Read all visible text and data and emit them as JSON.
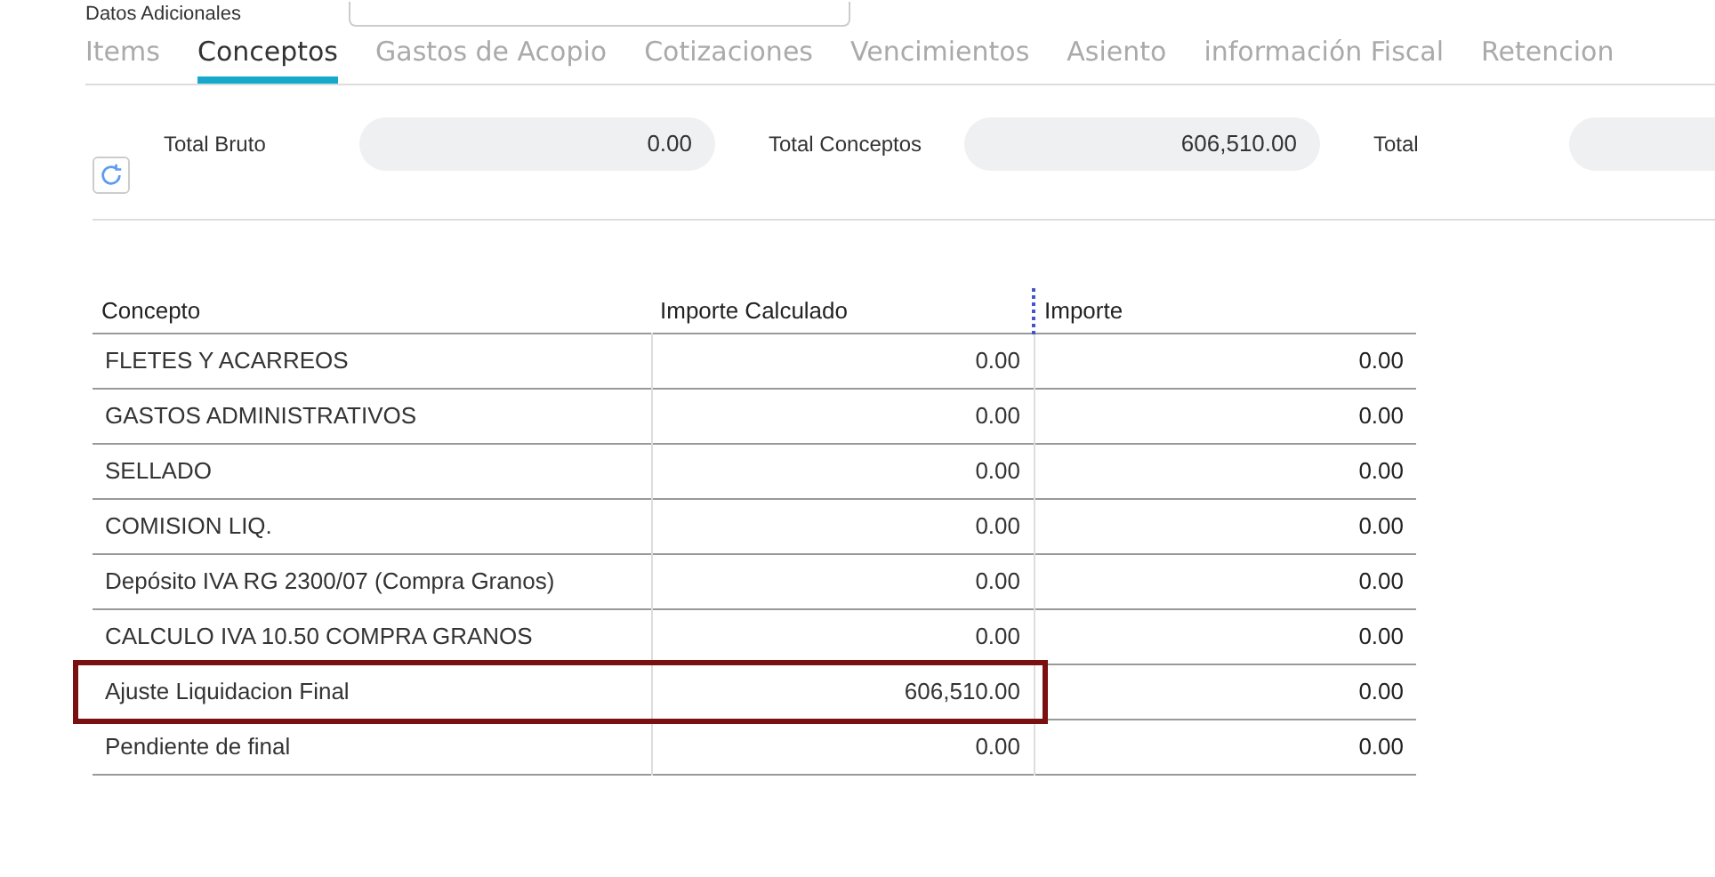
{
  "top_field": {
    "label": "Datos Adicionales"
  },
  "tabs": [
    {
      "label": "Items",
      "selected": false
    },
    {
      "label": "Conceptos",
      "selected": true
    },
    {
      "label": "Gastos de Acopio",
      "selected": false
    },
    {
      "label": "Cotizaciones",
      "selected": false
    },
    {
      "label": "Vencimientos",
      "selected": false
    },
    {
      "label": "Asiento",
      "selected": false
    },
    {
      "label": "información Fiscal",
      "selected": false
    },
    {
      "label": "Retencion",
      "selected": false
    }
  ],
  "totals": [
    {
      "label": "Total Bruto",
      "value": "0.00"
    },
    {
      "label": "Total Conceptos",
      "value": "606,510.00"
    },
    {
      "label": "Total"
    }
  ],
  "table": {
    "columns": [
      "Concepto",
      "Importe Calculado",
      "Importe"
    ],
    "rows": [
      {
        "concepto": "FLETES Y ACARREOS",
        "calculado": "0.00",
        "importe": "0.00",
        "highlighted": false
      },
      {
        "concepto": "GASTOS ADMINISTRATIVOS",
        "calculado": "0.00",
        "importe": "0.00",
        "highlighted": false
      },
      {
        "concepto": "SELLADO",
        "calculado": "0.00",
        "importe": "0.00",
        "highlighted": false
      },
      {
        "concepto": "COMISION LIQ.",
        "calculado": "0.00",
        "importe": "0.00",
        "highlighted": false
      },
      {
        "concepto": "Depósito IVA RG 2300/07 (Compra Granos)",
        "calculado": "0.00",
        "importe": "0.00",
        "highlighted": false
      },
      {
        "concepto": "CALCULO IVA 10.50 COMPRA GRANOS",
        "calculado": "0.00",
        "importe": "0.00",
        "highlighted": false
      },
      {
        "concepto": "Ajuste Liquidacion Final",
        "calculado": "606,510.00",
        "importe": "0.00",
        "highlighted": true
      },
      {
        "concepto": "Pendiente de final",
        "calculado": "0.00",
        "importe": "0.00",
        "highlighted": false
      }
    ]
  }
}
